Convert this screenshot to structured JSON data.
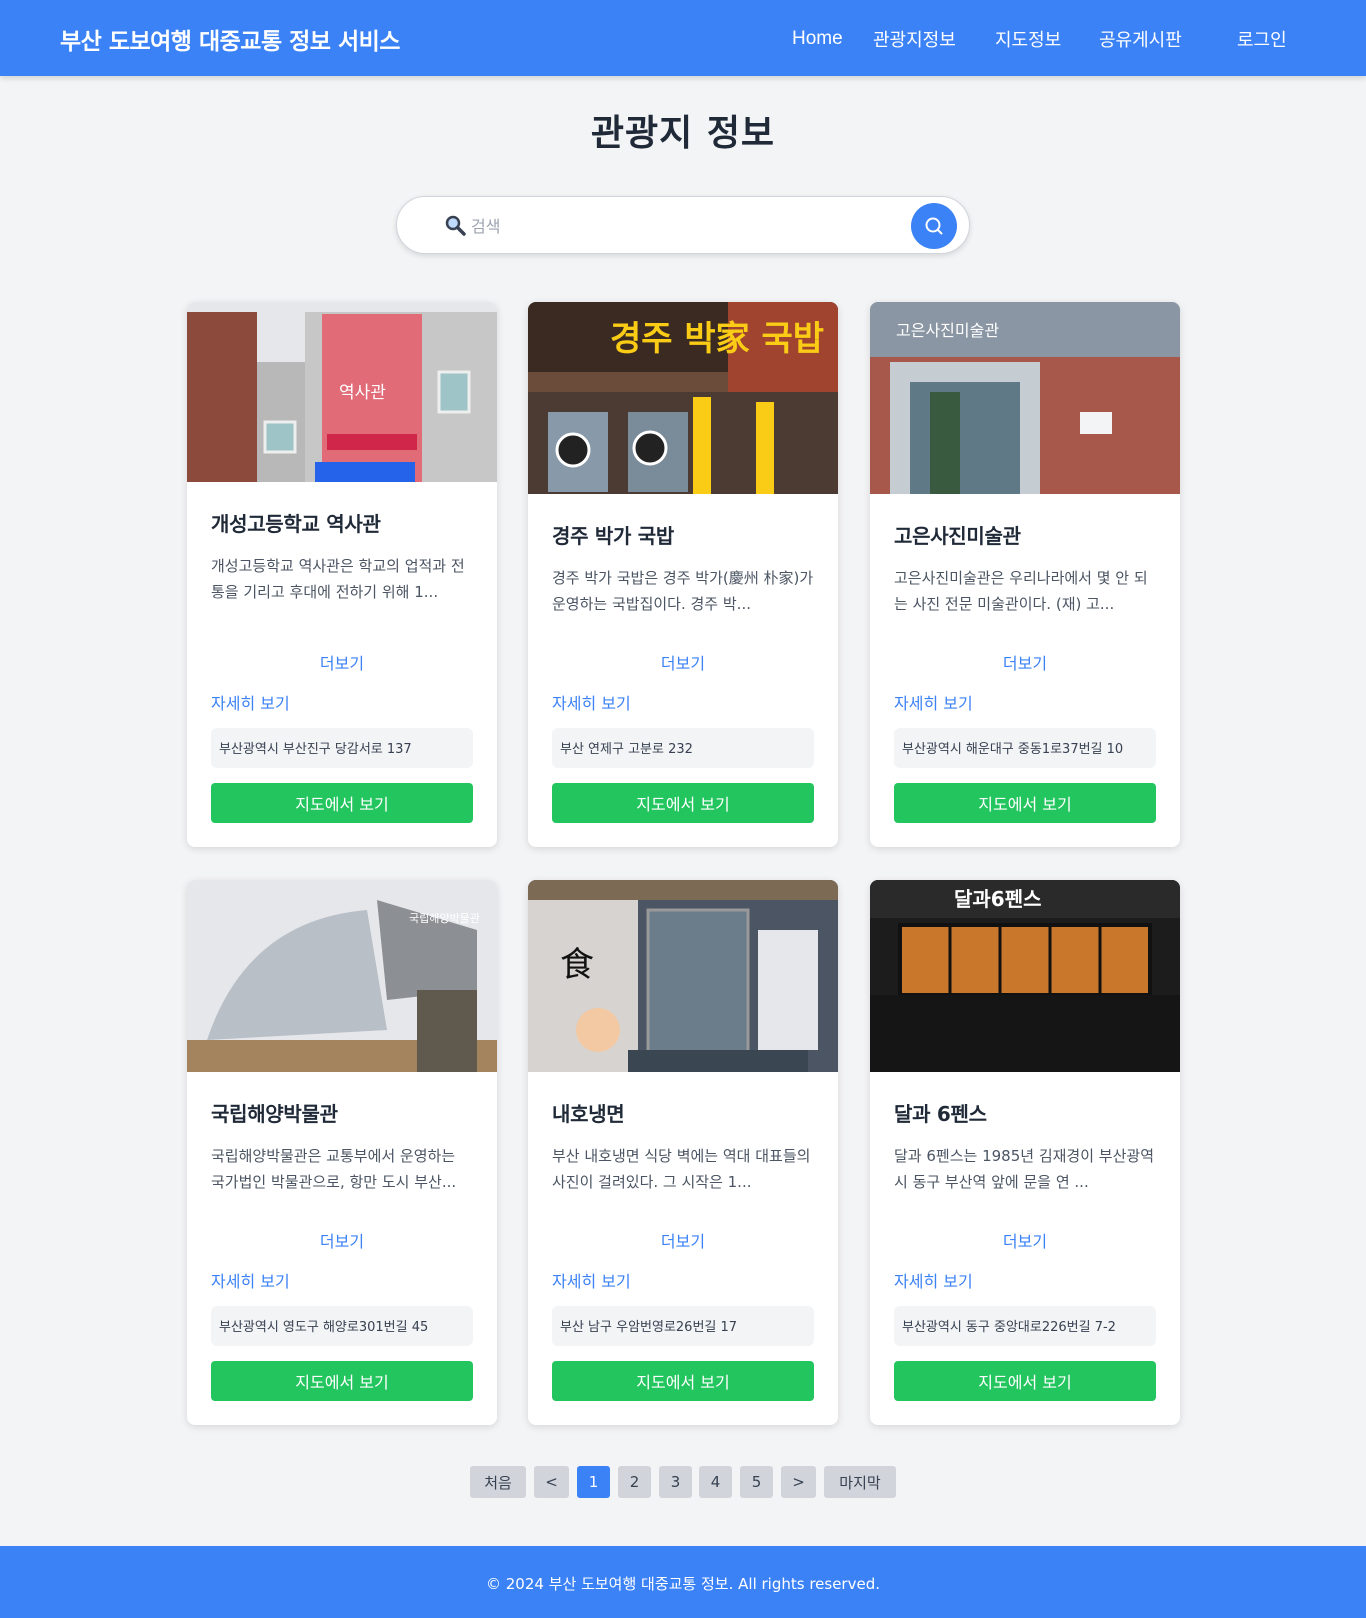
{
  "header": {
    "brand": "부산 도보여행 대중교통 정보 서비스",
    "nav": [
      "Home",
      "관광지정보",
      "지도정보",
      "공유게시판",
      "로그인"
    ]
  },
  "page_title": "관광지 정보",
  "search": {
    "placeholder": "검색",
    "icon": "🔍"
  },
  "cards": [
    {
      "title": "개성고등학교 역사관",
      "description": "개성고등학교 역사관은 학교의 업적과 전통을 기리고 후대에 전하기 위해 1...",
      "more": "더보기",
      "detail": "자세히 보기",
      "address": "부산광역시 부산진구 당감서로 137",
      "map_button": "지도에서 보기",
      "image_sign": "역사관"
    },
    {
      "title": "경주 박가 국밥",
      "description": "경주 박가 국밥은 경주 박가(慶州 朴家)가 운영하는 국밥집이다. 경주 박...",
      "more": "더보기",
      "detail": "자세히 보기",
      "address": "부산 연제구 고분로 232",
      "map_button": "지도에서 보기",
      "image_sign": "경주 박家 국밥"
    },
    {
      "title": "고은사진미술관",
      "description": "고은사진미술관은 우리나라에서 몇 안 되는 사진 전문 미술관이다. (재) 고...",
      "more": "더보기",
      "detail": "자세히 보기",
      "address": "부산광역시 해운대구 중동1로37번길 10",
      "map_button": "지도에서 보기",
      "image_sign": "고은사진미술관"
    },
    {
      "title": "국립해양박물관",
      "description": "국립해양박물관은 교통부에서 운영하는 국가법인 박물관으로, 항만 도시 부산...",
      "more": "더보기",
      "detail": "자세히 보기",
      "address": "부산광역시 영도구 해양로301번길 45",
      "map_button": "지도에서 보기",
      "image_sign": "국립해양박물관"
    },
    {
      "title": "내호냉면",
      "description": "부산 내호냉면 식당 벽에는 역대 대표들의 사진이 걸려있다. 그 시작은 1...",
      "more": "더보기",
      "detail": "자세히 보기",
      "address": "부산 남구 우암번영로26번길 17",
      "map_button": "지도에서 보기",
      "image_sign": "食"
    },
    {
      "title": "달과 6펜스",
      "description": "달과 6펜스는 1985년 김재경이 부산광역시 동구 부산역 앞에 문을 연 ...",
      "more": "더보기",
      "detail": "자세히 보기",
      "address": "부산광역시 동구 중앙대로226번길 7-2",
      "map_button": "지도에서 보기",
      "image_sign": "달과6펜스"
    }
  ],
  "pagination": {
    "first": "처음",
    "prev": "<",
    "pages": [
      "1",
      "2",
      "3",
      "4",
      "5"
    ],
    "active": "1",
    "next": ">",
    "last": "마지막"
  },
  "footer": {
    "text": "© 2024 부산 도보여행 대중교통 정보. All rights reserved."
  },
  "colors": {
    "primary": "#3b82f6",
    "success": "#22c55e",
    "background": "#f3f4f6"
  }
}
